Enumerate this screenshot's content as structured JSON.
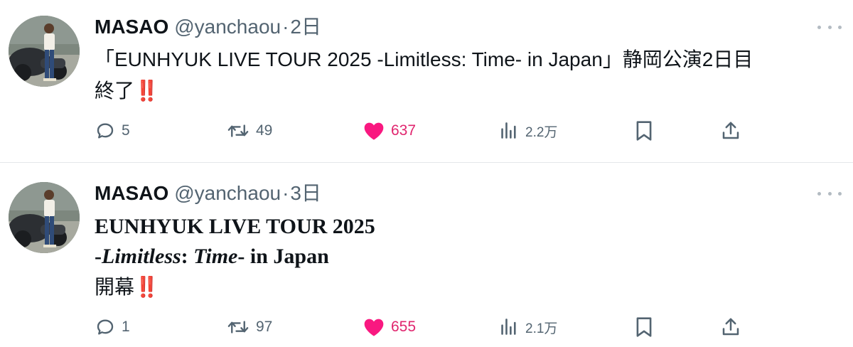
{
  "colors": {
    "like": "#e0256e",
    "meta": "#536471",
    "divider": "#e4e7ea",
    "exclamation": "#e02020"
  },
  "tweets": [
    {
      "author": {
        "name": "MASAO",
        "handle": "@yanchaou"
      },
      "separator": "·",
      "date": "2日",
      "text_line1": "「EUNHYUK LIVE TOUR 2025 -Limitless: Time- in Japan」静岡公演2日目",
      "text_line2": "終了",
      "emoji": "‼️",
      "stats": {
        "replies": "5",
        "retweets": "49",
        "likes": "637",
        "views": "2.2万"
      },
      "icons": [
        "reply-icon",
        "retweet-icon",
        "heart-icon",
        "views-icon",
        "bookmark-icon",
        "share-icon"
      ]
    },
    {
      "author": {
        "name": "MASAO",
        "handle": "@yanchaou"
      },
      "separator": "·",
      "date": "3日",
      "text_line1": "EUNHYUK LIVE TOUR 2025",
      "text_line2_parts": [
        "-",
        "Limitless",
        ": ",
        "Time",
        "- in Japan"
      ],
      "text_line3": "開幕",
      "emoji": "‼️",
      "stats": {
        "replies": "1",
        "retweets": "97",
        "likes": "655",
        "views": "2.1万"
      },
      "icons": [
        "reply-icon",
        "retweet-icon",
        "heart-icon",
        "views-icon",
        "bookmark-icon",
        "share-icon"
      ]
    }
  ]
}
